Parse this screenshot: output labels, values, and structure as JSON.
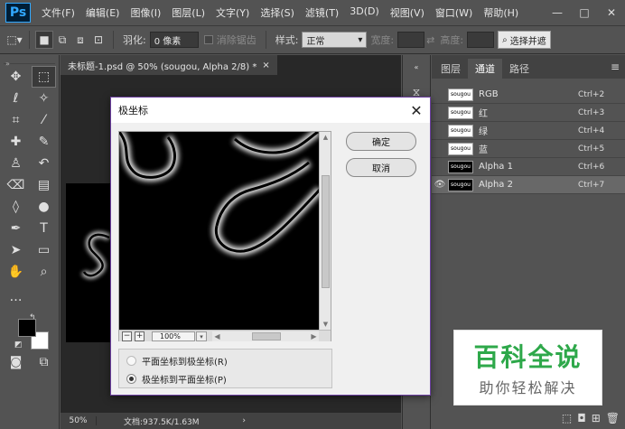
{
  "app": {
    "logo": "Ps",
    "menus": [
      "文件(F)",
      "编辑(E)",
      "图像(I)",
      "图层(L)",
      "文字(Y)",
      "选择(S)",
      "滤镜(T)",
      "3D(D)",
      "视图(V)",
      "窗口(W)",
      "帮助(H)"
    ],
    "window_controls": [
      "—",
      "□",
      "✕"
    ]
  },
  "options": {
    "feather_label": "羽化:",
    "feather_value": "0 像素",
    "antialias_label": "消除锯齿",
    "style_label": "样式:",
    "style_value": "正常",
    "width_label": "宽度:",
    "height_label": "高度:",
    "select_mask_button": "选择并遮"
  },
  "document": {
    "tab_title": "未标题-1.psd @ 50% (sougou, Alpha 2/8) *",
    "tab_close": "×",
    "zoom": "50%",
    "doc_info": "文档:937.5K/1.63M"
  },
  "panels": {
    "tabs": [
      "图层",
      "通道",
      "路径"
    ],
    "active_tab": "通道",
    "channels": [
      {
        "thumb": "sougou",
        "name": "RGB",
        "shortcut": "Ctrl+2",
        "dark": false,
        "selected": false,
        "eye": false
      },
      {
        "thumb": "sougou",
        "name": "红",
        "shortcut": "Ctrl+3",
        "dark": false,
        "selected": false,
        "eye": false
      },
      {
        "thumb": "sougou",
        "name": "绿",
        "shortcut": "Ctrl+4",
        "dark": false,
        "selected": false,
        "eye": false
      },
      {
        "thumb": "sougou",
        "name": "蓝",
        "shortcut": "Ctrl+5",
        "dark": false,
        "selected": false,
        "eye": false
      },
      {
        "thumb": "sougou",
        "name": "Alpha 1",
        "shortcut": "Ctrl+6",
        "dark": true,
        "selected": false,
        "eye": false
      },
      {
        "thumb": "sougou",
        "name": "Alpha 2",
        "shortcut": "Ctrl+7",
        "dark": true,
        "selected": true,
        "eye": true
      }
    ]
  },
  "dialog": {
    "title": "极坐标",
    "ok_button": "确定",
    "cancel_button": "取消",
    "zoom_value": "100%",
    "option_rect_to_polar": "平面坐标到极坐标(R)",
    "option_polar_to_rect": "极坐标到平面坐标(P)",
    "selected_option": "polar_to_rect"
  },
  "watermark": {
    "main": "百科全说",
    "sub": "助你轻松解决"
  }
}
